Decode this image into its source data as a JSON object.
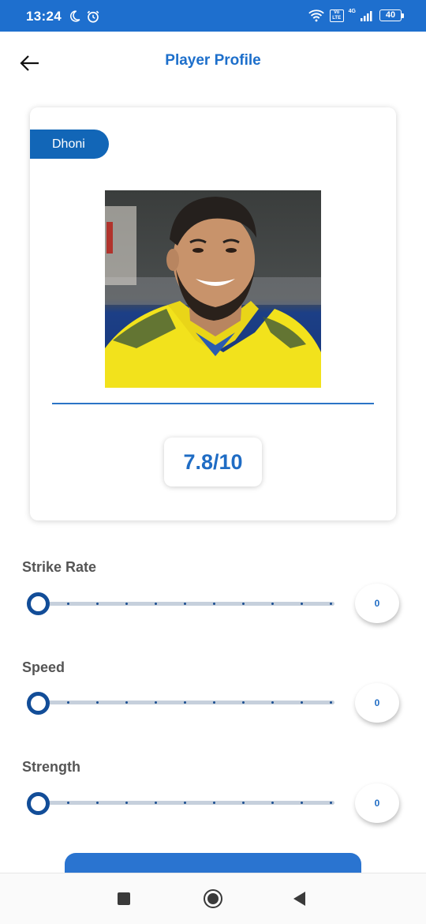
{
  "status_bar": {
    "time": "13:24",
    "volte": "Vo LTE",
    "network_type": "4G",
    "battery": "40"
  },
  "header": {
    "title": "Player Profile"
  },
  "player": {
    "name": "Dhoni",
    "rating": "7.8/10"
  },
  "stats": [
    {
      "label": "Strike Rate",
      "value": "0"
    },
    {
      "label": "Speed",
      "value": "0"
    },
    {
      "label": "Strength",
      "value": "0"
    }
  ],
  "colors": {
    "primary": "#1e6fce",
    "accent": "#124d98",
    "title": "#1d6fcb"
  },
  "nav_bar": {
    "icons": [
      "recents-icon",
      "home-icon",
      "back-icon"
    ]
  }
}
